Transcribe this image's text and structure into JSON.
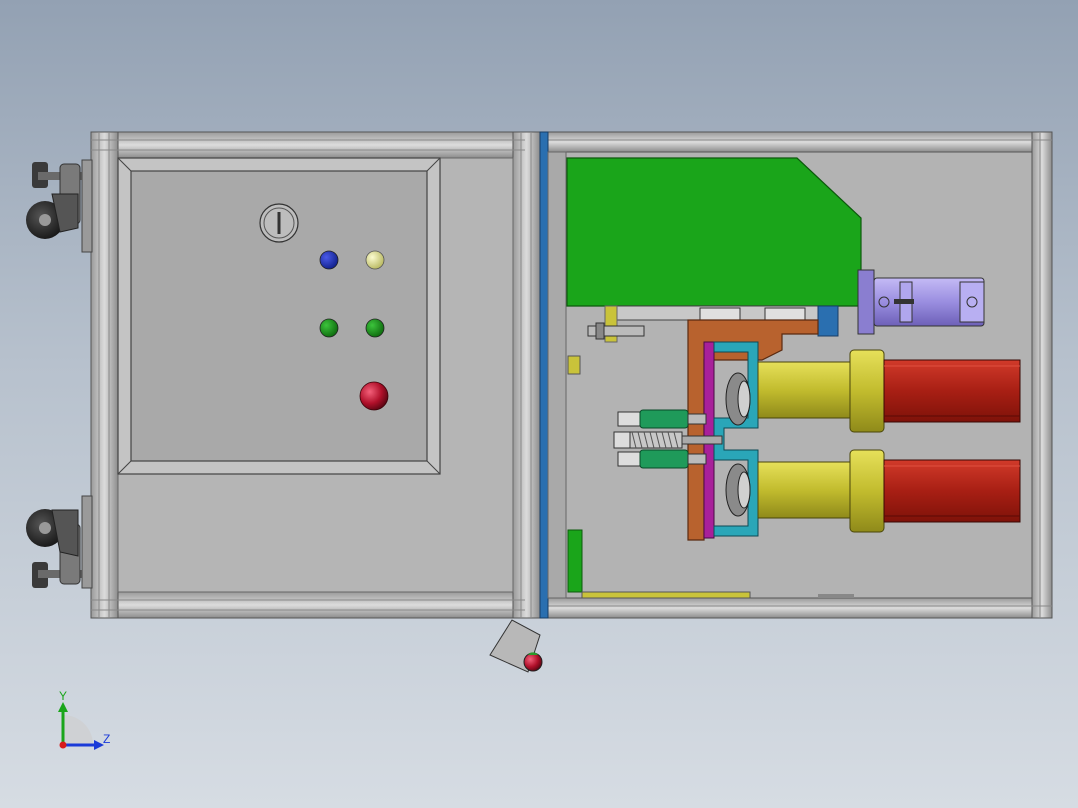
{
  "viewport": {
    "background_top": "#93a1b3",
    "background_bottom": "#d6dce3"
  },
  "model": {
    "frame_color": "#c8c8c8",
    "panel_color": "#a9a9a9",
    "green_plate_color": "#1aa51a",
    "motor_red_color": "#b0261a",
    "motor_yellow_color": "#c9c33a",
    "purple_motor_color": "#9a8ee0",
    "bracket_orange_color": "#b8622e",
    "plate_magenta_color": "#a8209a",
    "bracket_cyan_color": "#2aa6b8",
    "blue_rail_color": "#2a6fb0"
  },
  "control_panel": {
    "power_switch_icon": "power-switch-icon",
    "indicators": [
      {
        "name": "blue-indicator-light",
        "color": "#1a2aa8"
      },
      {
        "name": "yellow-indicator-light",
        "color": "#e8e89a"
      },
      {
        "name": "green-indicator-light-left",
        "color": "#1e8e1e"
      },
      {
        "name": "green-indicator-light-right",
        "color": "#1e8e1e"
      }
    ],
    "emergency_stop_color": "#c0102a"
  },
  "triad": {
    "y_label": "Y",
    "z_label": "Z",
    "y_color": "#1aa51a",
    "z_color": "#1a3ad8",
    "x_color": "#d81a1a"
  }
}
